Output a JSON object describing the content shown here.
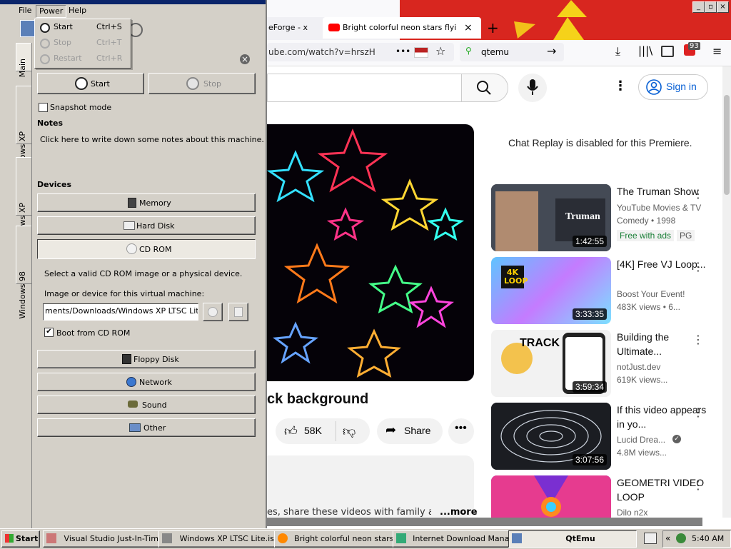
{
  "browser": {
    "tabs": [
      {
        "label": "eForge - x"
      },
      {
        "label": "Bright colorful neon stars flying in"
      }
    ],
    "new_tab": "+",
    "url": "ube.com/watch?v=hrszH",
    "search_value": "qtemu",
    "more_dots": "•••",
    "badge_count": "93",
    "window_controls": {
      "min": "_",
      "max": "▫",
      "close": "×"
    }
  },
  "youtube": {
    "sign_in": "Sign in",
    "chat_replay": "Chat Replay is disabled for this Premiere.",
    "video_title": "ck background",
    "likes": "58K",
    "share": "Share",
    "description_tail": "es, share these videos with family an",
    "more": "...more",
    "recommendations": [
      {
        "title": "The Truman Show",
        "meta1": "YouTube Movies & TV",
        "meta2": "Comedy • 1998",
        "badge1": "Free with ads",
        "badge2": "PG",
        "duration": "1:42:55",
        "thumb_text": "Truman"
      },
      {
        "title": "[4K] Free VJ Loop...",
        "meta1": "Boost Your Event!",
        "meta2": "483K views  • 6...",
        "duration": "3:33:35",
        "thumb_text": "4K LOOP"
      },
      {
        "title": "Building the Ultimate...",
        "meta1": "notJust.dev",
        "meta2": "619K views...",
        "duration": "3:59:34",
        "thumb_text": "TRACK"
      },
      {
        "title": "If this video appears in yo...",
        "meta1": "Lucid Drea...",
        "meta2": "4.8M views...",
        "duration": "3:07:56"
      },
      {
        "title": "GEOMETRI VIDEO LOOP",
        "meta1": "Dilo n2x"
      }
    ]
  },
  "qtemu": {
    "menu": {
      "file": "File",
      "power": "Power",
      "help": "Help"
    },
    "power_menu": [
      {
        "label": "Start",
        "shortcut": "Ctrl+S",
        "enabled": true
      },
      {
        "label": "Stop",
        "shortcut": "Ctrl+T",
        "enabled": false
      },
      {
        "label": "Restart",
        "shortcut": "Ctrl+R",
        "enabled": false
      }
    ],
    "side_tabs": [
      "Main",
      "Windows XP",
      "Windows XP",
      "Windows 98"
    ],
    "start": "Start",
    "stop": "Stop",
    "snapshot_mode": "Snapshot mode",
    "notes_header": "Notes",
    "notes_text": "Click here to write down some notes about this machine.",
    "devices_header": "Devices",
    "devices": {
      "memory": "Memory",
      "hard_disk": "Hard Disk",
      "cd_rom": "CD ROM",
      "floppy": "Floppy Disk",
      "network": "Network",
      "sound": "Sound",
      "other": "Other"
    },
    "cd_help": "Select a valid CD ROM image or a physical device.",
    "image_label": "Image or device for this virtual machine:",
    "image_path": "ments/Downloads/Windows XP LTSC Lite.iso",
    "boot_from_cd": "Boot from CD ROM",
    "close_glyph": "×"
  },
  "taskbar": {
    "start": "Start",
    "items": [
      "Visual Studio Just-In-Tim...",
      "Windows XP LTSC Lite.is...",
      "Bright colorful neon stars...",
      "Internet Download Mana...",
      "QtEmu"
    ],
    "tray_arrows": "«",
    "clock": "5:40 AM"
  },
  "colors": {
    "xp_face": "#d4d0c8",
    "yt_red": "#ff0000",
    "sign_in_blue": "#065fd4",
    "free_green": "#1a7f37"
  }
}
